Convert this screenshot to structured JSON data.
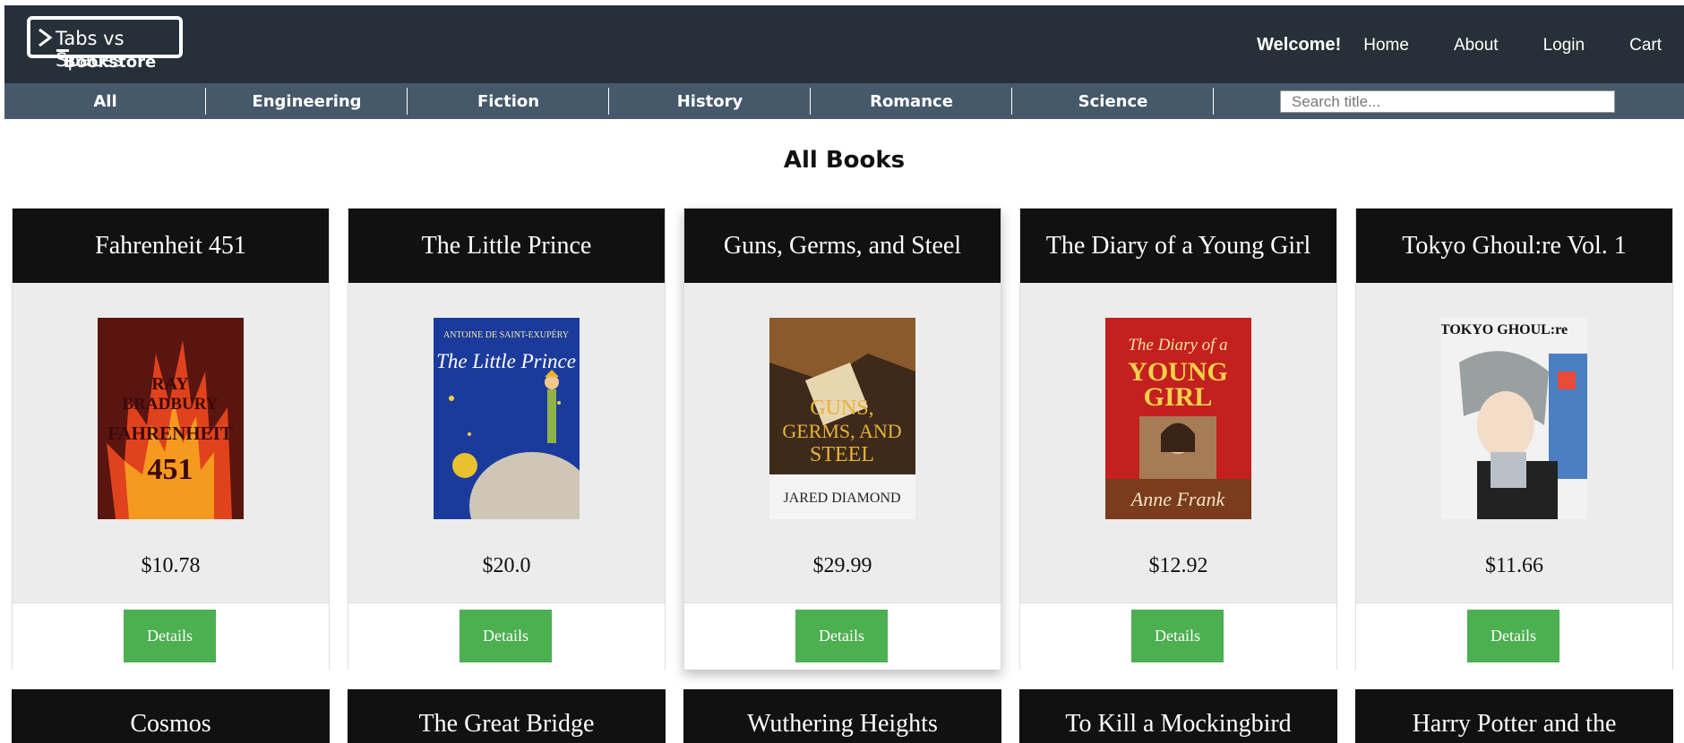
{
  "header": {
    "logo_text": "Tabs vs Spaces",
    "logo_sub": "Bookstore",
    "welcome": "Welcome!",
    "nav": [
      "Home",
      "About",
      "Login",
      "Cart"
    ]
  },
  "categories": [
    "All",
    "Engineering",
    "Fiction",
    "History",
    "Romance",
    "Science"
  ],
  "search": {
    "placeholder": "Search title..."
  },
  "main": {
    "heading": "All Books"
  },
  "books": [
    {
      "title": "Fahrenheit 451",
      "price": "$10.78",
      "button": "Details",
      "cover": {
        "bg": "#5a1510",
        "lines": [
          "RAY",
          "BRADBURY",
          "FAHRENHEIT",
          "451"
        ]
      }
    },
    {
      "title": "The Little Prince",
      "price": "$20.0",
      "button": "Details",
      "cover": {
        "bg": "#1b3b9c",
        "lines": [
          "ANTOINE DE SAINT-EXUPÉRY",
          "The Little Prince"
        ]
      }
    },
    {
      "title": "Guns, Germs, and Steel",
      "price": "$29.99",
      "button": "Details",
      "cover": {
        "bg": "#3d2a1a",
        "lines": [
          "GUNS,",
          "GERMS, AND",
          "STEEL",
          "JARED DIAMOND"
        ]
      }
    },
    {
      "title": "The Diary of a Young Girl",
      "price": "$12.92",
      "button": "Details",
      "cover": {
        "bg": "#c3201f",
        "lines": [
          "The Diary of a",
          "YOUNG",
          "GIRL",
          "Anne Frank"
        ]
      }
    },
    {
      "title": "Tokyo Ghoul:re Vol. 1",
      "price": "$11.66",
      "button": "Details",
      "cover": {
        "bg": "#f2f2f2",
        "lines": [
          "TOKYO GHOUL:re"
        ]
      }
    }
  ],
  "books_row2": [
    "Cosmos",
    "The Great Bridge",
    "Wuthering Heights",
    "To Kill a Mockingbird",
    "Harry Potter and the"
  ]
}
